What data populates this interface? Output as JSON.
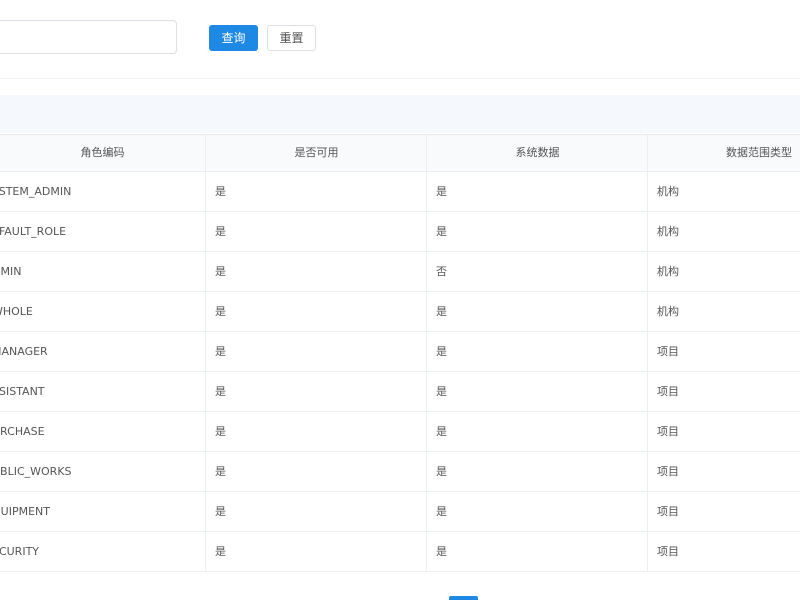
{
  "search": {
    "query_label": "查询",
    "reset_label": "重置"
  },
  "table": {
    "headers": [
      "角色编码",
      "是否可用",
      "系统数据",
      "数据范围类型"
    ],
    "rows": [
      [
        "YSTEM_ADMIN",
        "是",
        "是",
        "机构"
      ],
      [
        "EFAULT_ROLE",
        "是",
        "是",
        "机构"
      ],
      [
        "DMIN",
        "是",
        "否",
        "机构"
      ],
      [
        "WHOLE",
        "是",
        "是",
        "机构"
      ],
      [
        "MANAGER",
        "是",
        "是",
        "项目"
      ],
      [
        "SSISTANT",
        "是",
        "是",
        "项目"
      ],
      [
        "URCHASE",
        "是",
        "是",
        "项目"
      ],
      [
        "UBLIC_WORKS",
        "是",
        "是",
        "项目"
      ],
      [
        "QUIPMENT",
        "是",
        "是",
        "项目"
      ],
      [
        "ECURITY",
        "是",
        "是",
        "项目"
      ]
    ]
  },
  "colors": {
    "primary": "#1e88e5",
    "toolbar_bg": "#f5f8fc",
    "border": "#ebeef2"
  }
}
